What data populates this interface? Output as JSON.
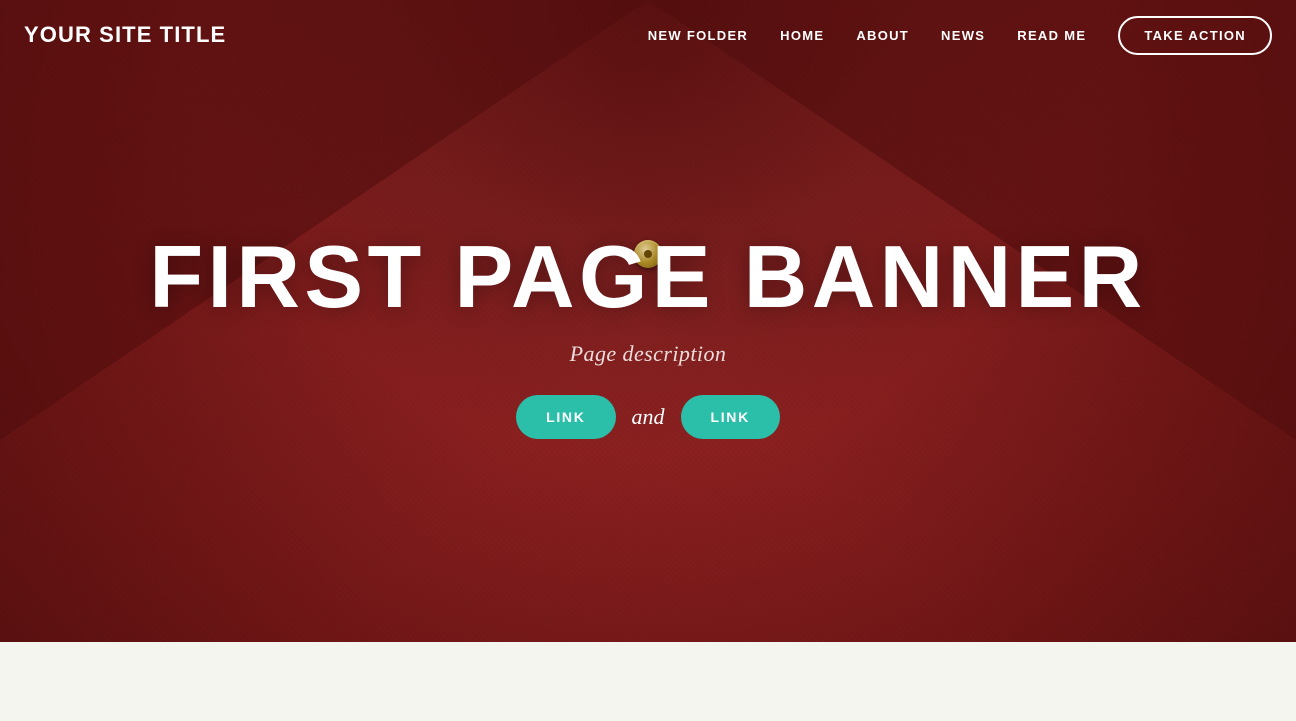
{
  "navbar": {
    "site_title": "YOUR SITE TITLE",
    "links": [
      {
        "label": "NEW FOLDER",
        "key": "new-folder"
      },
      {
        "label": "HOME",
        "key": "home"
      },
      {
        "label": "ABOUT",
        "key": "about"
      },
      {
        "label": "NEWS",
        "key": "news"
      },
      {
        "label": "READ ME",
        "key": "read-me"
      }
    ],
    "cta_label": "TAKE ACTION"
  },
  "hero": {
    "banner_title": "FIRST PAGE BANNER",
    "description": "Page description",
    "link1_label": "LINK",
    "and_text": "and",
    "link2_label": "LINK"
  }
}
